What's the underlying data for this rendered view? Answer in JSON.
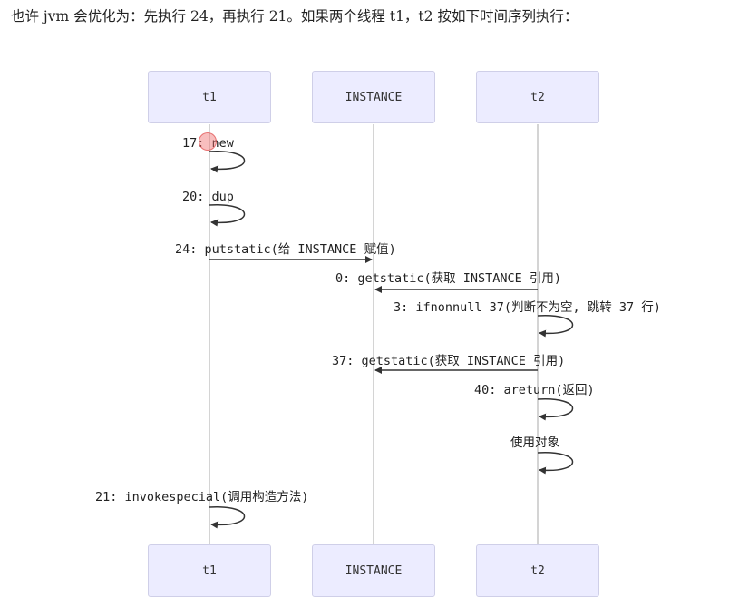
{
  "intro_text": "也许 jvm 会优化为：先执行 24，再执行 21。如果两个线程 t1，t2 按如下时间序列执行：",
  "participants": {
    "t1": "t1",
    "instance": "INSTANCE",
    "t2": "t2"
  },
  "messages": {
    "m17": "17: new",
    "m20": "20: dup",
    "m24": "24: putstatic(给 INSTANCE 赋值)",
    "m0": "0: getstatic(获取 INSTANCE 引用)",
    "m3": "3: ifnonnull 37(判断不为空, 跳转 37 行)",
    "m37": "37: getstatic(获取 INSTANCE 引用)",
    "m40": "40: areturn(返回)",
    "use": "使用对象",
    "m21": "21: invokespecial(调用构造方法)"
  },
  "colors": {
    "actor_fill": "#ececff",
    "actor_border": "#cfcfe8",
    "lifeline": "#aaaaaa",
    "arrow": "#333333",
    "cursor_highlight": "#f06e6e"
  }
}
